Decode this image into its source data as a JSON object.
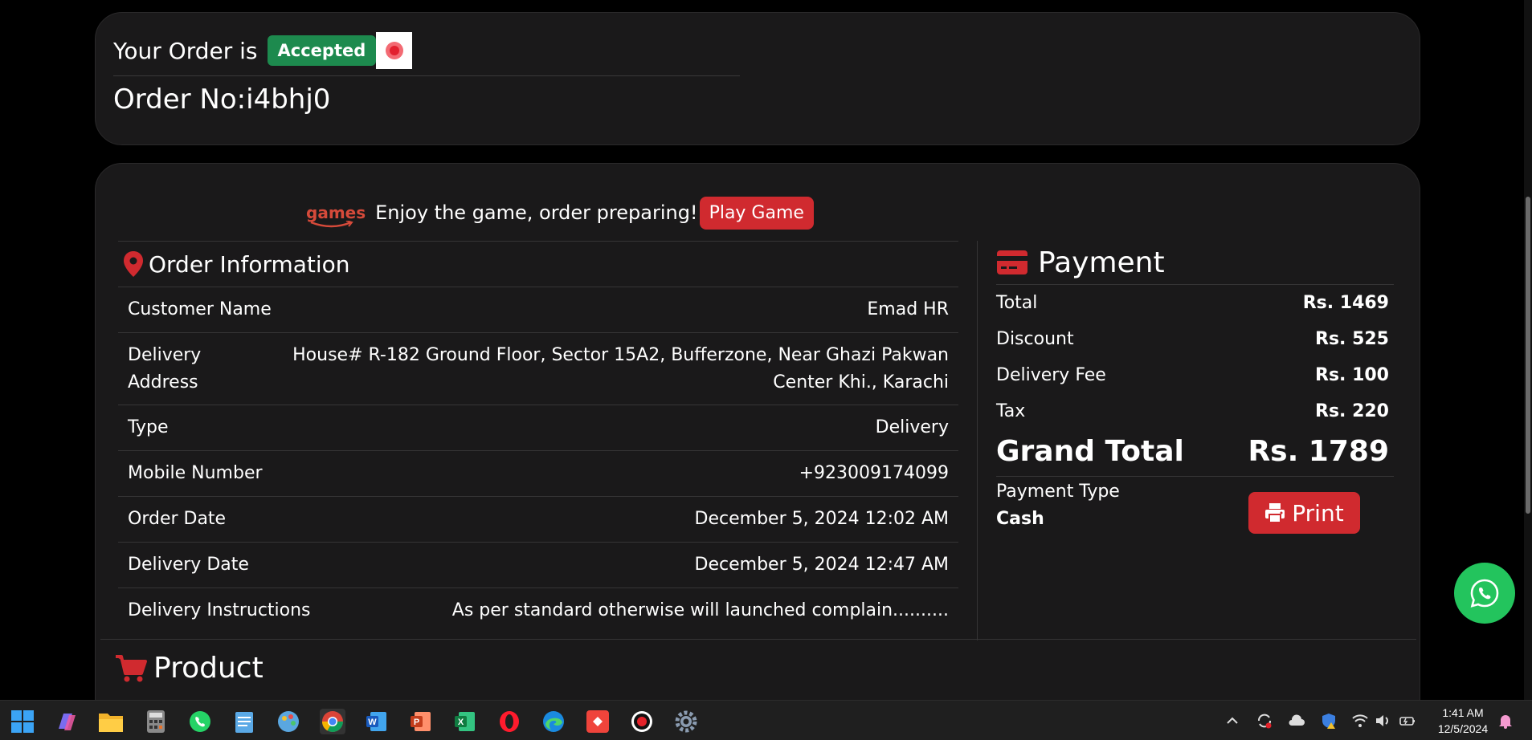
{
  "status": {
    "prefix": "Your Order is",
    "badge": "Accepted",
    "order_no": "Order No:i4bhj0"
  },
  "game": {
    "logo_text": "games",
    "message": "Enjoy the game, order preparing!",
    "button_label": "Play Game"
  },
  "order_info": {
    "title": "Order Information",
    "rows": [
      {
        "key": "Customer Name",
        "value": "Emad HR"
      },
      {
        "key": "Delivery Address",
        "value": "House# R-182 Ground Floor, Sector 15A2, Bufferzone, Near Ghazi Pakwan Center Khi., Karachi"
      },
      {
        "key": "Type",
        "value": "Delivery"
      },
      {
        "key": "Mobile Number",
        "value": "+923009174099"
      },
      {
        "key": "Order Date",
        "value": "December 5, 2024 12:02 AM"
      },
      {
        "key": "Delivery Date",
        "value": "December 5, 2024 12:47 AM"
      },
      {
        "key": "Delivery Instructions",
        "value": "As per standard otherwise will launched complain.........."
      }
    ]
  },
  "payment": {
    "title": "Payment",
    "rows": [
      {
        "key": "Total",
        "value": "Rs. 1469"
      },
      {
        "key": "Discount",
        "value": "Rs. 525"
      },
      {
        "key": "Delivery Fee",
        "value": "Rs. 100"
      },
      {
        "key": "Tax",
        "value": "Rs. 220"
      }
    ],
    "grand_total_label": "Grand Total",
    "grand_total_value": "Rs. 1789",
    "payment_type_label": "Payment Type",
    "payment_type_value": "Cash",
    "print_label": "Print"
  },
  "product": {
    "title": "Product"
  },
  "taskbar": {
    "time": "1:41 AM",
    "date": "12/5/2024"
  },
  "colors": {
    "accent_red": "#d02a2f",
    "badge_green": "#1d8a4e",
    "whatsapp_green": "#23c45d",
    "card_bg": "#1a191a"
  }
}
